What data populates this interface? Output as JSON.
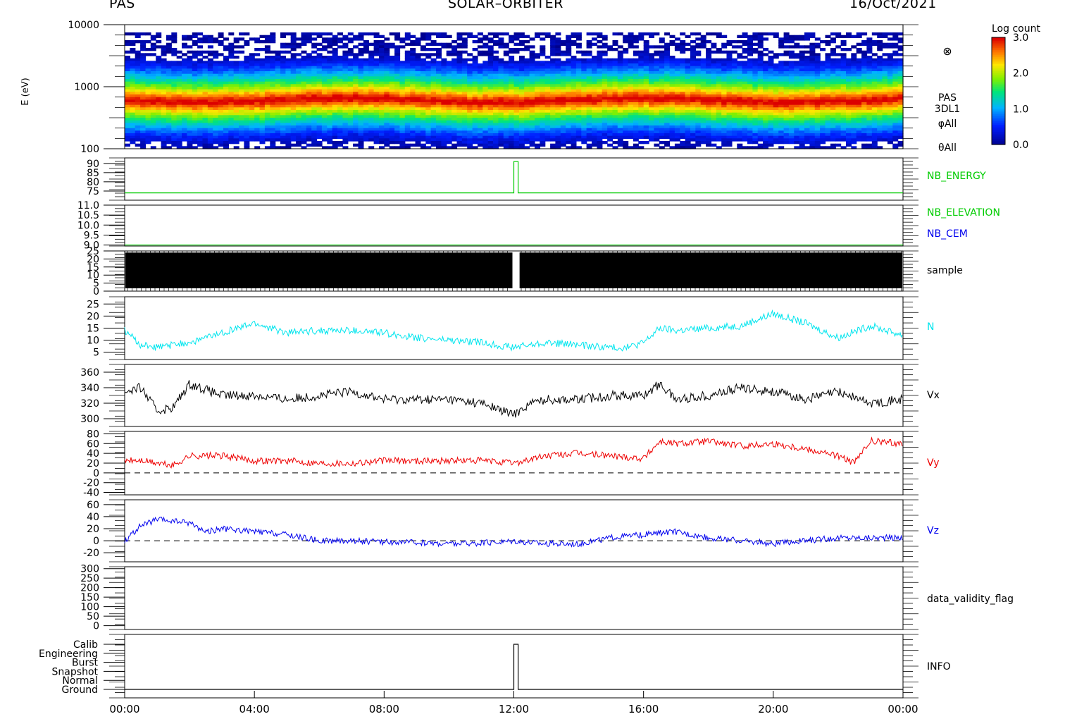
{
  "header": {
    "instrument": "PAS",
    "mission": "SOLAR–ORBITER",
    "date": "16/Oct/2021"
  },
  "colorbar": {
    "title": "Log count",
    "ticks": [
      "3.0",
      "2.0",
      "1.0",
      "0.0"
    ],
    "range": [
      0.0,
      3.0
    ]
  },
  "spectrogram_labels": {
    "symbol": "⊗",
    "line1": "PAS",
    "line2": "3DL1",
    "line3": "φAll",
    "line4": "θAll"
  },
  "chart_data": [
    {
      "type": "heatmap",
      "name": "spectrogram",
      "ylabel": "E (eV)",
      "yscale": "log",
      "ylim": [
        100,
        10000
      ],
      "yticks": [
        "10000",
        "1000",
        "100"
      ],
      "peak_energy_ev": 600
    },
    {
      "type": "line",
      "label": "NB_ENERGY",
      "color": "#00cc00",
      "ylim": [
        70,
        93
      ],
      "yticks": [
        90,
        85,
        80,
        75
      ],
      "series": [
        {
          "x": [
            "00:00",
            "12:00",
            "12:00",
            "12:08",
            "12:08",
            "24:00"
          ],
          "y": [
            74,
            74,
            91,
            91,
            74,
            74
          ]
        }
      ]
    },
    {
      "type": "line",
      "labels": [
        "NB_ELEVATION",
        "NB_CEM"
      ],
      "label_colors": [
        "#00cc00",
        "#0000ee"
      ],
      "ylim": [
        8.95,
        11.0
      ],
      "yticks": [
        "11.0",
        "10.5",
        "10.0",
        "9.5",
        "9.0"
      ],
      "series": [
        {
          "x": [
            "00:00",
            "24:00"
          ],
          "y": [
            9.0,
            9.0
          ],
          "color": "#00cc00"
        }
      ]
    },
    {
      "type": "bar",
      "label": "sample",
      "ylim": [
        0,
        25
      ],
      "yticks": [
        25,
        20,
        15,
        10,
        5,
        0
      ],
      "values_note_range": [
        0,
        25
      ],
      "gap": [
        "12:00",
        "12:08"
      ]
    },
    {
      "type": "line",
      "label": "N",
      "color": "#00e5ee",
      "ylim": [
        2,
        28
      ],
      "yticks": [
        25,
        20,
        15,
        10,
        5
      ],
      "series": [
        {
          "x": [
            "00:00",
            "00:30",
            "01:00",
            "02:00",
            "03:00",
            "04:00",
            "05:00",
            "06:00",
            "07:00",
            "08:00",
            "09:00",
            "10:00",
            "11:00",
            "12:00",
            "13:00",
            "14:00",
            "15:00",
            "15:30",
            "16:00",
            "16:30",
            "17:00",
            "18:00",
            "19:00",
            "20:00",
            "21:00",
            "22:00",
            "23:00",
            "24:00"
          ],
          "y": [
            14,
            8,
            7,
            9,
            13,
            17,
            13,
            14,
            14,
            13,
            11,
            10,
            9,
            7,
            9,
            8,
            7,
            7,
            9,
            15,
            14,
            15,
            16,
            21,
            17,
            11,
            16,
            12
          ]
        }
      ]
    },
    {
      "type": "line",
      "label": "Vx",
      "color": "#000000",
      "ylim": [
        290,
        370
      ],
      "yticks": [
        360,
        340,
        320,
        300
      ],
      "series": [
        {
          "x": [
            "00:00",
            "00:30",
            "01:00",
            "01:30",
            "02:00",
            "03:00",
            "04:00",
            "05:00",
            "06:00",
            "07:00",
            "08:00",
            "09:00",
            "10:00",
            "11:00",
            "12:00",
            "12:30",
            "13:00",
            "14:00",
            "15:00",
            "16:00",
            "16:30",
            "17:00",
            "18:00",
            "19:00",
            "20:00",
            "21:00",
            "22:00",
            "23:00",
            "24:00"
          ],
          "y": [
            335,
            340,
            310,
            315,
            345,
            330,
            330,
            325,
            330,
            335,
            325,
            325,
            325,
            320,
            305,
            320,
            325,
            325,
            330,
            330,
            345,
            325,
            330,
            340,
            335,
            325,
            335,
            320,
            325
          ]
        }
      ]
    },
    {
      "type": "line",
      "label": "Vy",
      "color": "#ee0000",
      "ylim": [
        -45,
        85
      ],
      "yticks": [
        80,
        60,
        40,
        20,
        0,
        -20,
        -40
      ],
      "baseline": 0,
      "series": [
        {
          "x": [
            "00:00",
            "00:30",
            "01:00",
            "01:30",
            "02:00",
            "03:00",
            "04:00",
            "05:00",
            "06:00",
            "07:00",
            "08:00",
            "09:00",
            "10:00",
            "11:00",
            "12:00",
            "13:00",
            "14:00",
            "15:00",
            "16:00",
            "16:30",
            "17:00",
            "18:00",
            "19:00",
            "20:00",
            "21:00",
            "22:00",
            "22:30",
            "23:00",
            "24:00"
          ],
          "y": [
            25,
            25,
            20,
            15,
            35,
            35,
            25,
            25,
            20,
            20,
            25,
            25,
            25,
            25,
            20,
            35,
            40,
            35,
            30,
            65,
            60,
            65,
            55,
            60,
            50,
            35,
            20,
            65,
            60
          ]
        }
      ]
    },
    {
      "type": "line",
      "label": "Vz",
      "color": "#0000ee",
      "ylim": [
        -35,
        68
      ],
      "yticks": [
        60,
        40,
        20,
        0,
        -20
      ],
      "baseline": 0,
      "series": [
        {
          "x": [
            "00:00",
            "00:30",
            "01:00",
            "02:00",
            "02:30",
            "03:00",
            "04:00",
            "05:00",
            "06:00",
            "07:00",
            "08:00",
            "09:00",
            "10:00",
            "11:00",
            "12:00",
            "13:00",
            "14:00",
            "15:00",
            "16:00",
            "17:00",
            "18:00",
            "19:00",
            "20:00",
            "21:00",
            "22:00",
            "23:00",
            "24:00"
          ],
          "y": [
            0,
            25,
            35,
            30,
            15,
            20,
            15,
            10,
            0,
            0,
            -2,
            -3,
            -5,
            -4,
            0,
            -5,
            -5,
            5,
            10,
            15,
            5,
            0,
            -5,
            0,
            5,
            5,
            5
          ]
        }
      ]
    },
    {
      "type": "line",
      "label": "data_validity_flag",
      "ylim": [
        -20,
        310
      ],
      "yticks": [
        300,
        250,
        200,
        150,
        100,
        50,
        0
      ],
      "series": []
    },
    {
      "type": "line",
      "label": "INFO",
      "categories": [
        "Calib",
        "Engineering",
        "Burst",
        "Snapshot",
        "Normal",
        "Ground"
      ],
      "series": [
        {
          "x": [
            "00:00",
            "12:00",
            "12:00",
            "12:08",
            "12:08",
            "24:00"
          ],
          "y": [
            "Ground",
            "Ground",
            "Calib",
            "Calib",
            "Ground",
            "Ground"
          ]
        }
      ]
    }
  ],
  "x_axis": {
    "ticks": [
      "00:00",
      "04:00",
      "08:00",
      "12:00",
      "16:00",
      "20:00",
      "00:00"
    ]
  }
}
